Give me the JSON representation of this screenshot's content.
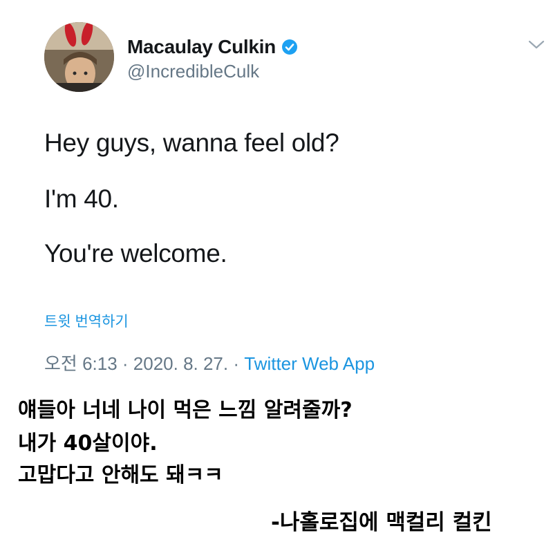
{
  "tweet": {
    "author": {
      "display_name": "Macaulay Culkin",
      "handle": "@IncredibleCulk",
      "verified": true,
      "avatar_icon": "profile-photo-bunny-ears"
    },
    "lines": [
      "Hey guys, wanna feel old?",
      "I'm 40.",
      "You're welcome."
    ],
    "translate_label": "트윗 번역하기",
    "meta": {
      "time": "오전 6:13",
      "separator": " · ",
      "date": "2020. 8. 27.",
      "source": "Twitter Web App"
    },
    "menu_icon": "chevron-down-icon"
  },
  "caption": {
    "lines": [
      "얘들아 너네 나이 먹은 느낌 알려줄까?",
      "내가 40살이야.",
      "고맙다고 안해도 돼ㅋㅋ"
    ],
    "signature": "-나홀로집에 맥컬리 컬킨"
  },
  "colors": {
    "text": "#14171a",
    "secondary": "#657786",
    "link": "#1b95e0",
    "verified": "#1da1f2"
  }
}
